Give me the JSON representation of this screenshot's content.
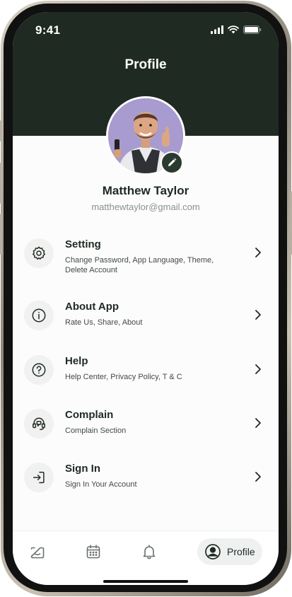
{
  "status_bar": {
    "time": "9:41"
  },
  "header": {
    "title": "Profile"
  },
  "user": {
    "name": "Matthew Taylor",
    "email": "matthewtaylor@gmail.com"
  },
  "menu": [
    {
      "title": "Setting",
      "subtitle": "Change Password, App Language, Theme, Delete Account",
      "icon": "gear-icon"
    },
    {
      "title": "About App",
      "subtitle": "Rate Us, Share, About",
      "icon": "info-icon"
    },
    {
      "title": "Help",
      "subtitle": "Help Center, Privacy Policy, T & C",
      "icon": "question-icon"
    },
    {
      "title": "Complain",
      "subtitle": "Complain Section",
      "icon": "headset-icon"
    },
    {
      "title": "Sign In",
      "subtitle": "Sign In Your Account",
      "icon": "sign-in-icon"
    }
  ],
  "tabbar": {
    "items": [
      {
        "icon": "home-icon"
      },
      {
        "icon": "calendar-icon"
      },
      {
        "icon": "bell-icon"
      },
      {
        "icon": "user-circle-icon",
        "label": "Profile",
        "active": true
      }
    ]
  },
  "colors": {
    "header": "#1f2a22",
    "background": "#fbfcfb",
    "text": "#1f2a22"
  }
}
